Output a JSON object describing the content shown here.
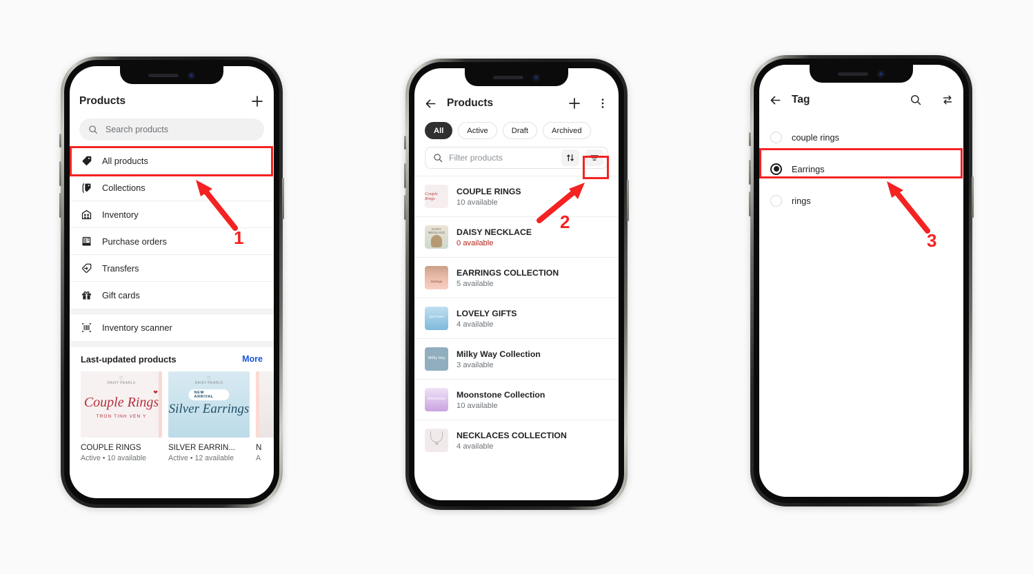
{
  "background_color": "#fafafa",
  "annotation_color": "#f42222",
  "phones": [
    {
      "id": "phone-products-menu",
      "appbar": {
        "title": "Products",
        "add_icon": "plus-icon"
      },
      "search": {
        "placeholder": "Search products",
        "icon": "search-icon"
      },
      "nav_items": [
        {
          "label": "All products",
          "icon": "tag-icon",
          "highlighted": true
        },
        {
          "label": "Collections",
          "icon": "collections-icon",
          "highlighted": false
        },
        {
          "label": "Inventory",
          "icon": "inventory-icon",
          "highlighted": false
        },
        {
          "label": "Purchase orders",
          "icon": "purchase-orders-icon",
          "highlighted": false
        },
        {
          "label": "Transfers",
          "icon": "transfers-icon",
          "highlighted": false
        },
        {
          "label": "Gift cards",
          "icon": "gift-card-icon",
          "highlighted": false
        }
      ],
      "nav_items_secondary": [
        {
          "label": "Inventory scanner",
          "icon": "barcode-scanner-icon"
        }
      ],
      "section": {
        "title": "Last-updated products",
        "more_label": "More"
      },
      "cards": [
        {
          "title": "COUPLE RINGS",
          "meta": "Active • 10 available",
          "art_title": "Couple Rings",
          "art_sub": "TRON TINH VEN Y",
          "bg": "#f7f1f1",
          "ink": "#b5303c"
        },
        {
          "title": "SILVER EARRIN...",
          "meta": "Active • 12 available",
          "art_title": "Silver Earrings",
          "art_sub": "NEW ARRIVAL",
          "bg": "#cfe4ee",
          "ink": "#1f4f66"
        },
        {
          "title": "N",
          "meta": "A",
          "art_title": "",
          "art_sub": "",
          "bg": "#f3eeee",
          "ink": "#b5303c"
        }
      ]
    },
    {
      "id": "phone-products-list",
      "appbar": {
        "back_icon": "back-arrow-icon",
        "title": "Products",
        "add_icon": "plus-icon",
        "more_icon": "overflow-menu-icon"
      },
      "chips": [
        {
          "label": "All",
          "active": true
        },
        {
          "label": "Active",
          "active": false
        },
        {
          "label": "Draft",
          "active": false
        },
        {
          "label": "Archived",
          "active": false
        }
      ],
      "filter": {
        "placeholder": "Filter products",
        "search_icon": "search-icon",
        "sort_icon": "sort-icon",
        "filter_icon": "filter-icon",
        "filter_highlighted": true
      },
      "products": [
        {
          "name": "COUPLE RINGS",
          "qty": "10 available",
          "zero": false,
          "thumb_bg": "#f6eeee",
          "thumb_ink": "#c0414a"
        },
        {
          "name": "DAISY NECKLACE",
          "qty": "0 available",
          "zero": true,
          "thumb_bg": "#e6ddd3",
          "thumb_ink": "#6c6356"
        },
        {
          "name": "EARRINGS COLLECTION",
          "qty": "5 available",
          "zero": false,
          "thumb_bg": "#f6c9c0",
          "thumb_ink": "#8b4a42"
        },
        {
          "name": "LOVELY GIFTS",
          "qty": "4 available",
          "zero": false,
          "thumb_bg": "#a8d2e8",
          "thumb_ink": "#ffffff"
        },
        {
          "name": "Milky Way Collection",
          "qty": "3 available",
          "zero": false,
          "thumb_bg": "#91aebe",
          "thumb_ink": "#ffffff"
        },
        {
          "name": "Moonstone Collection",
          "qty": "10 available",
          "zero": false,
          "thumb_bg": "#d7bfe8",
          "thumb_ink": "#ffffff"
        },
        {
          "name": "NECKLACES COLLECTION",
          "qty": "4 available",
          "zero": false,
          "thumb_bg": "#efe6e6",
          "thumb_ink": "#9a9a9a"
        }
      ]
    },
    {
      "id": "phone-tag-filter",
      "appbar": {
        "back_icon": "back-arrow-icon",
        "title": "Tag",
        "search_icon": "search-icon",
        "swap_icon": "swap-icon"
      },
      "tags": [
        {
          "label": "couple rings",
          "selected": false,
          "highlighted": false
        },
        {
          "label": "Earrings",
          "selected": true,
          "highlighted": true
        },
        {
          "label": "rings",
          "selected": false,
          "highlighted": false
        }
      ]
    }
  ],
  "annotations": [
    {
      "number": "1",
      "target": "all-products-row"
    },
    {
      "number": "2",
      "target": "filter-button"
    },
    {
      "number": "3",
      "target": "earrings-tag-row"
    }
  ]
}
